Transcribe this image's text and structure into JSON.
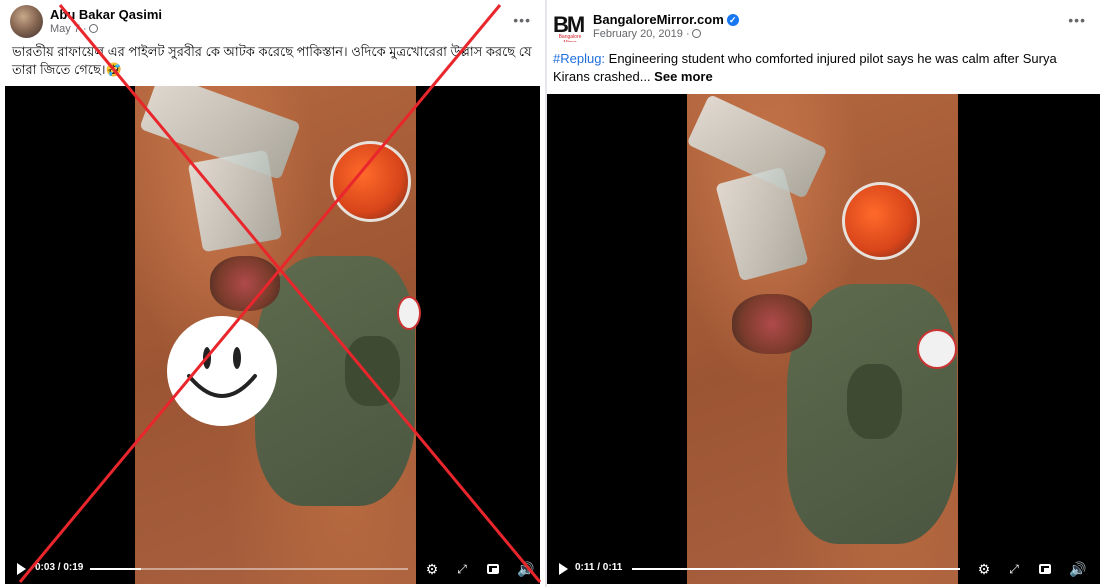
{
  "left_post": {
    "author": "Abu Bakar Qasimi",
    "date": "May 7 ·",
    "text": "ভারতীয় রাফায়েল এর পাইলট সুরবীর কে আটক করেছে পাকিস্তান। ওদিকে মুত্রখোরেরা উল্লাস করছে যে তারা জিতে গেছে।🤣",
    "more_label": "•••",
    "video": {
      "time": "0:03 / 0:19",
      "progress": 0.16
    },
    "overlay": "red-x"
  },
  "right_post": {
    "author": "BangaloreMirror.com",
    "logo_text": "BM",
    "logo_sub": "Bangalore Mirror",
    "date": "February 20, 2019 ·",
    "hashtag": "#Replug:",
    "text": " Engineering student who comforted injured pilot says he was calm after Surya Kirans crashed...",
    "see_more": "See more",
    "more_label": "•••",
    "video": {
      "time": "0:11 / 0:11",
      "progress": 1.0
    }
  },
  "colors": {
    "accent": "#1877f2",
    "hashtag": "#216fdb",
    "x_mark": "#e8262c"
  },
  "icons": [
    "play-icon",
    "settings-icon",
    "fullscreen-icon",
    "pip-icon",
    "volume-icon",
    "globe-icon",
    "verified-icon",
    "smiley-icon"
  ]
}
